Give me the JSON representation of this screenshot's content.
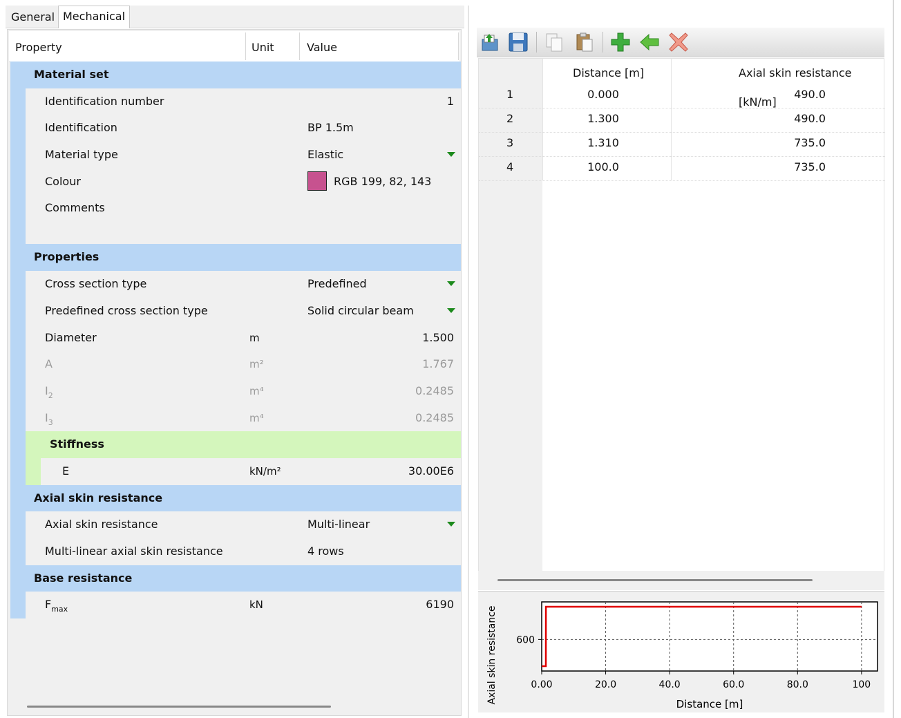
{
  "tabs": {
    "general": "General",
    "mechanical": "Mechanical"
  },
  "grid_header": {
    "property": "Property",
    "unit": "Unit",
    "value": "Value"
  },
  "rows": {
    "material_set": "Material set",
    "identification_number": {
      "label": "Identification number",
      "value": "1"
    },
    "identification": {
      "label": "Identification",
      "value": "BP 1.5m"
    },
    "material_type": {
      "label": "Material type",
      "value": "Elastic"
    },
    "colour": {
      "label": "Colour",
      "value": "RGB 199, 82, 143",
      "swatch": "#c7528f"
    },
    "comments": {
      "label": "Comments"
    },
    "properties": "Properties",
    "cross_section_type": {
      "label": "Cross section type",
      "value": "Predefined"
    },
    "predefined_cross_section_type": {
      "label": "Predefined cross section type",
      "value": "Solid circular beam"
    },
    "diameter": {
      "label": "Diameter",
      "unit": "m",
      "value": "1.500"
    },
    "area": {
      "label": "A",
      "unit": "m²",
      "value": "1.767"
    },
    "i2": {
      "label": "I",
      "sub": "2",
      "unit": "m⁴",
      "value": "0.2485"
    },
    "i3": {
      "label": "I",
      "sub": "3",
      "unit": "m⁴",
      "value": "0.2485"
    },
    "stiffness": "Stiffness",
    "e": {
      "label": "E",
      "unit": "kN/m²",
      "value": "30.00E6"
    },
    "axial_skin_resistance_section": "Axial skin resistance",
    "axial_skin_resistance": {
      "label": "Axial skin resistance",
      "value": "Multi-linear"
    },
    "multi_linear": {
      "label": "Multi-linear axial skin resistance",
      "value": "4 rows"
    },
    "base_resistance": "Base resistance",
    "fmax": {
      "label": "F",
      "sub": "max",
      "unit": "kN",
      "value": "6190"
    }
  },
  "toolbar": {
    "icons": [
      "open-icon",
      "save-icon",
      "copy-icon",
      "paste-icon",
      "add-row-icon",
      "insert-row-icon",
      "delete-row-icon"
    ]
  },
  "table": {
    "headers": {
      "distance": "Distance [m]",
      "resistance": "Axial skin resistance [kN/m]"
    },
    "rows": [
      {
        "n": "1",
        "distance": "0.000",
        "resistance": "490.0"
      },
      {
        "n": "2",
        "distance": "1.300",
        "resistance": "490.0"
      },
      {
        "n": "3",
        "distance": "1.310",
        "resistance": "735.0"
      },
      {
        "n": "4",
        "distance": "100.0",
        "resistance": "735.0"
      }
    ]
  },
  "colors": {
    "section": "#b8d6f5",
    "subsection": "#d4f6bc",
    "line": "#e00000",
    "dropdown": "#1c8a1c"
  },
  "chart_data": {
    "type": "line",
    "xlabel": "Distance [m]",
    "ylabel": "Axial skin resistance",
    "x": [
      0.0,
      1.3,
      1.31,
      100.0
    ],
    "series": [
      {
        "values": [
          490.0,
          490.0,
          735.0,
          735.0
        ]
      }
    ],
    "xticks": [
      "0.00",
      "20.0",
      "40.0",
      "60.0",
      "80.0",
      "100"
    ],
    "yticks": [
      "600"
    ],
    "xlim": [
      0,
      105
    ],
    "ylim": [
      470,
      755
    ],
    "grid": true
  }
}
